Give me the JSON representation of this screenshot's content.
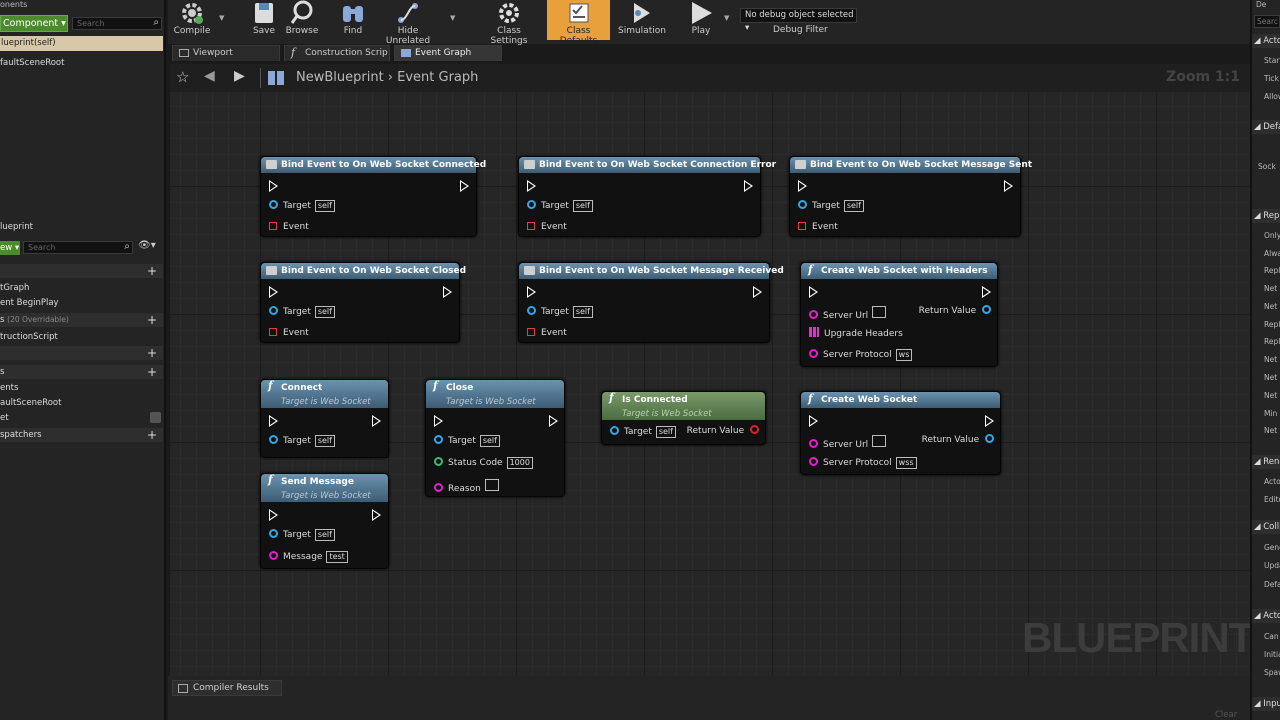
{
  "left_panel": {
    "components_header": "onents",
    "add_component": "Component",
    "search_placeholder": "Search",
    "selected": "lueprint(self)",
    "root": "faultSceneRoot",
    "mybp_header": "lueprint",
    "add_new": "ew",
    "search2_placeholder": "Search",
    "items": {
      "graphs_child": "tGraph",
      "graphs_child2": "ent BeginPlay",
      "functions": "s",
      "functions_sub": "(20 Overridable)",
      "construction": "tructionScript",
      "variables": "s",
      "components": "ents",
      "comp_root": "aultSceneRoot",
      "var_et": "et",
      "dispatchers": "spatchers"
    }
  },
  "toolbar": {
    "compile": "Compile",
    "save": "Save",
    "browse": "Browse",
    "find": "Find",
    "hide_unrelated": "Hide Unrelated",
    "class_settings": "Class Settings",
    "class_defaults": "Class Defaults",
    "simulation": "Simulation",
    "play": "Play",
    "debug_select": "No debug object selected",
    "debug_filter": "Debug Filter"
  },
  "tabs": {
    "viewport": "Viewport",
    "construction": "Construction Scrip",
    "event_graph": "Event Graph"
  },
  "breadcrumb": {
    "bp": "NewBlueprint",
    "graph": "Event Graph",
    "zoom": "Zoom 1:1"
  },
  "nodes": {
    "n1": {
      "title": "Bind Event to On Web Socket Connected",
      "target": "Target",
      "self": "self",
      "event": "Event"
    },
    "n2": {
      "title": "Bind Event to On Web Socket Connection Error",
      "target": "Target",
      "self": "self",
      "event": "Event"
    },
    "n3": {
      "title": "Bind Event to On Web Socket Message Sent",
      "target": "Target",
      "self": "self",
      "event": "Event"
    },
    "n4": {
      "title": "Bind Event to On Web Socket Closed",
      "target": "Target",
      "self": "self",
      "event": "Event"
    },
    "n5": {
      "title": "Bind Event to On Web Socket Message Received",
      "target": "Target",
      "self": "self",
      "event": "Event"
    },
    "n6": {
      "title": "Create Web Socket with Headers",
      "server_url": "Server Url",
      "return_value": "Return Value",
      "upgrade_headers": "Upgrade Headers",
      "server_protocol": "Server Protocol",
      "protocol_value": "ws"
    },
    "n7": {
      "title": "Connect",
      "subtitle": "Target is Web Socket",
      "target": "Target",
      "self": "self"
    },
    "n8": {
      "title": "Close",
      "subtitle": "Target is Web Socket",
      "target": "Target",
      "self": "self",
      "status_code": "Status Code",
      "status_value": "1000",
      "reason": "Reason"
    },
    "n9": {
      "title": "Is Connected",
      "subtitle": "Target is Web Socket",
      "target": "Target",
      "self": "self",
      "return_value": "Return Value"
    },
    "n10": {
      "title": "Create Web Socket",
      "server_url": "Server Url",
      "return_value": "Return Value",
      "server_protocol": "Server Protocol",
      "protocol_value": "wss"
    },
    "n11": {
      "title": "Send Message",
      "subtitle": "Target is Web Socket",
      "target": "Target",
      "self": "self",
      "message": "Message",
      "message_value": "test"
    }
  },
  "watermark": "BLUEPRINT",
  "bottom": {
    "compiler_results": "Compiler Results",
    "clear": "Clear"
  },
  "right_panel": {
    "header": "De",
    "search": "Searc",
    "sections": {
      "actor_tick": "Acto",
      "tick1": "Start",
      "tick2": "Tick",
      "tick3": "Allow",
      "defaults": "Defa",
      "sock": "Sock",
      "replication": "Repli",
      "r1": "Only",
      "r2": "Alwa",
      "r3": "Repli",
      "r4": "Net L",
      "r5": "Net U",
      "r6": "Repli",
      "r7": "Repli",
      "r8": "Net D",
      "r9": "Net C",
      "r10": "Net U",
      "r11": "Min N",
      "r12": "Net P",
      "rendering": "Rend",
      "re1": "Acto",
      "re2": "Edito",
      "collision": "Colli",
      "c1": "Gene",
      "c2": "Upda",
      "c3": "Defa",
      "actor": "Acto",
      "a1": "Can I",
      "a2": "Initia",
      "a3": "Spaw",
      "input": "Inpu"
    }
  }
}
